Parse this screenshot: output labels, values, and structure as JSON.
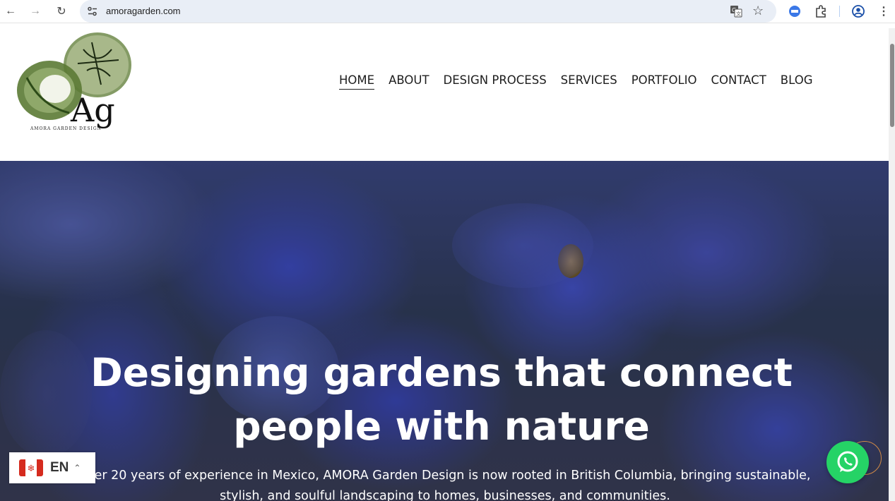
{
  "browser": {
    "url": "amoragarden.com",
    "icons": [
      "back-icon",
      "forward-icon",
      "reload-icon",
      "site-settings-icon",
      "translate-icon",
      "star-icon",
      "extension-icon",
      "puzzle-icon",
      "profile-icon",
      "menu-icon"
    ]
  },
  "logo": {
    "monogram": "Ag",
    "caption": "AMORA GARDEN DESIGN"
  },
  "nav": {
    "items": [
      "HOME",
      "ABOUT",
      "DESIGN PROCESS",
      "SERVICES",
      "PORTFOLIO",
      "CONTACT",
      "BLOG"
    ],
    "active": "HOME"
  },
  "hero": {
    "heading_line1": "Designing gardens that connect",
    "heading_line2": "people with nature",
    "text_line1": "over 20 years of experience in Mexico, AMORA Garden Design is now rooted in British Columbia, bringing sustainable,",
    "text_line2": "stylish, and soulful landscaping to homes, businesses, and communities."
  },
  "language": {
    "code": "EN",
    "flag": "canada-flag-icon"
  },
  "colors": {
    "whatsapp": "#25d366",
    "scrolltop_ring": "#d28a46",
    "omnibox_bg": "#e9eef6"
  }
}
